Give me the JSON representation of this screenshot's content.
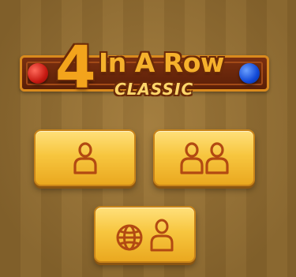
{
  "logo": {
    "number": "4",
    "title": "In A Row",
    "subtitle": "CLASSIC"
  },
  "colors": {
    "disc_left": "#d42318",
    "disc_right": "#1a4fe0",
    "button_fill": "#f7c63f",
    "icon_color": "#b24a12"
  },
  "menu": {
    "buttons": [
      {
        "id": "single-player",
        "icon": "person-icon"
      },
      {
        "id": "two-player",
        "icon": "two-persons-icon"
      },
      {
        "id": "online-player",
        "icon": "globe-person-icon"
      }
    ]
  }
}
